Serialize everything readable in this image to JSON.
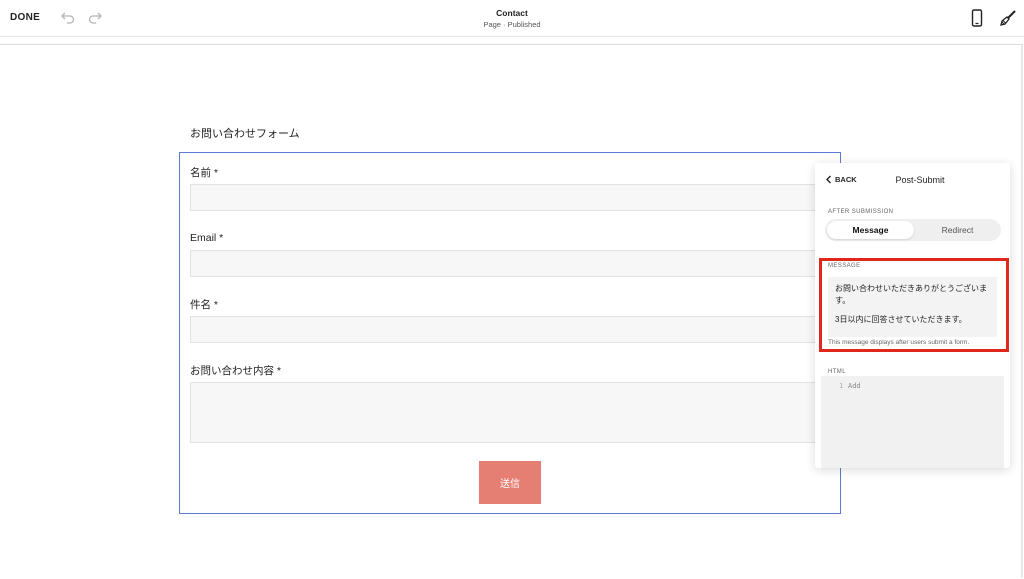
{
  "topbar": {
    "done_label": "DONE",
    "title": "Contact",
    "subtitle": "Page · Published",
    "icons": [
      "undo-icon",
      "redo-icon",
      "mobile-preview-icon",
      "design-brush-icon"
    ]
  },
  "form": {
    "heading": "お問い合わせフォーム",
    "fields": [
      {
        "label": "名前 *"
      },
      {
        "label": "Email *"
      },
      {
        "label": "件名 *"
      },
      {
        "label": "お問い合わせ内容 *"
      }
    ],
    "submit_label": "送信",
    "colors": {
      "border": "#5b7bd5",
      "submit_bg": "#e57f73"
    }
  },
  "panel": {
    "back_label": "BACK",
    "title": "Post-Submit",
    "after_submission_label": "AFTER SUBMISSION",
    "options": [
      "Message",
      "Redirect"
    ],
    "selected_option": "Message",
    "message_label": "MESSAGE",
    "message_lines": [
      "お問い合わせいただきありがとうございます。",
      "3日以内に回答させていただきます。"
    ],
    "message_help": "This message displays after users submit a form.",
    "html_label": "HTML",
    "html_line_number": "1",
    "html_placeholder": "Add",
    "highlight_color": "#e0281a"
  }
}
